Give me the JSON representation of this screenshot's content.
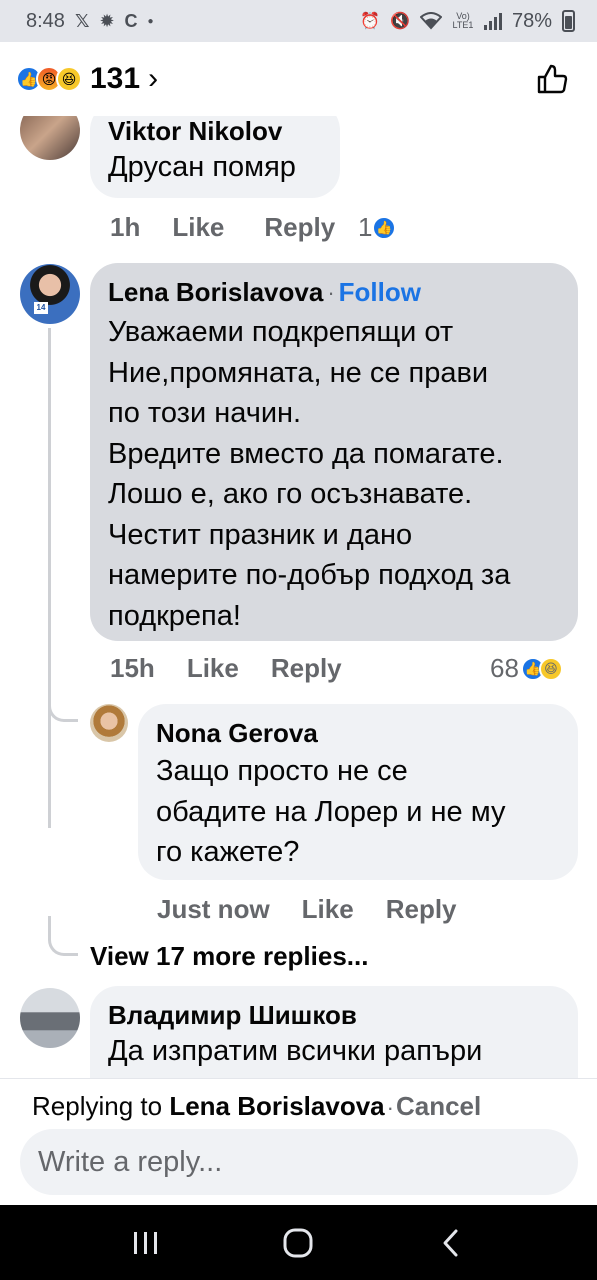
{
  "status_bar": {
    "time": "8:48",
    "notif_icons": [
      "x-icon",
      "gear-icon",
      "c-icon",
      "dot-icon"
    ],
    "right_icons": [
      "alarm-icon",
      "mute-icon",
      "wifi-icon",
      "volte-icon",
      "signal-icon"
    ],
    "volte_label": "Vo) LTE1",
    "battery": "78%"
  },
  "header": {
    "reaction_icons": [
      "like-icon",
      "angry-icon",
      "haha-icon"
    ],
    "reaction_count": "131",
    "chevron": "›",
    "like_icon": "thumbs-up-icon"
  },
  "comments": [
    {
      "author": "Viktor Nikolov",
      "text": "Друсан помяр",
      "time": "1h",
      "like_label": "Like",
      "reply_label": "Reply",
      "reaction_count": "1"
    },
    {
      "author": "Lena Borislavova",
      "follow_label": "Follow",
      "dot": "·",
      "text_lines": [
        "Уважаеми подкрепящи от",
        "Ние,промяната, не се прави",
        "по този начин.",
        "Вредите вместо да помагате.",
        "Лошо е, ако го осъзнавате.",
        "Честит празник и дано",
        "намерите по-добър подход за",
        "подкрепа!"
      ],
      "avatar_badge": "14",
      "time": "15h",
      "like_label": "Like",
      "reply_label": "Reply",
      "reaction_count": "68"
    },
    {
      "author": "Nona Gerova",
      "text_lines": [
        "Защо просто не се",
        "обадите на Лорер и не му",
        "го кажете?"
      ],
      "time": "Just now",
      "like_label": "Like",
      "reply_label": "Reply"
    },
    {
      "author": "Владимир Шишков",
      "text": "Да изпратим всички рапъри"
    }
  ],
  "view_more": "View 17 more replies...",
  "composer": {
    "replying_to_label": "Replying to",
    "replying_to_name": "Lena Borislavova",
    "dot": "·",
    "cancel_label": "Cancel",
    "placeholder": "Write a reply..."
  },
  "navbar": {
    "recents": "|||",
    "home": "○",
    "back": "‹"
  }
}
